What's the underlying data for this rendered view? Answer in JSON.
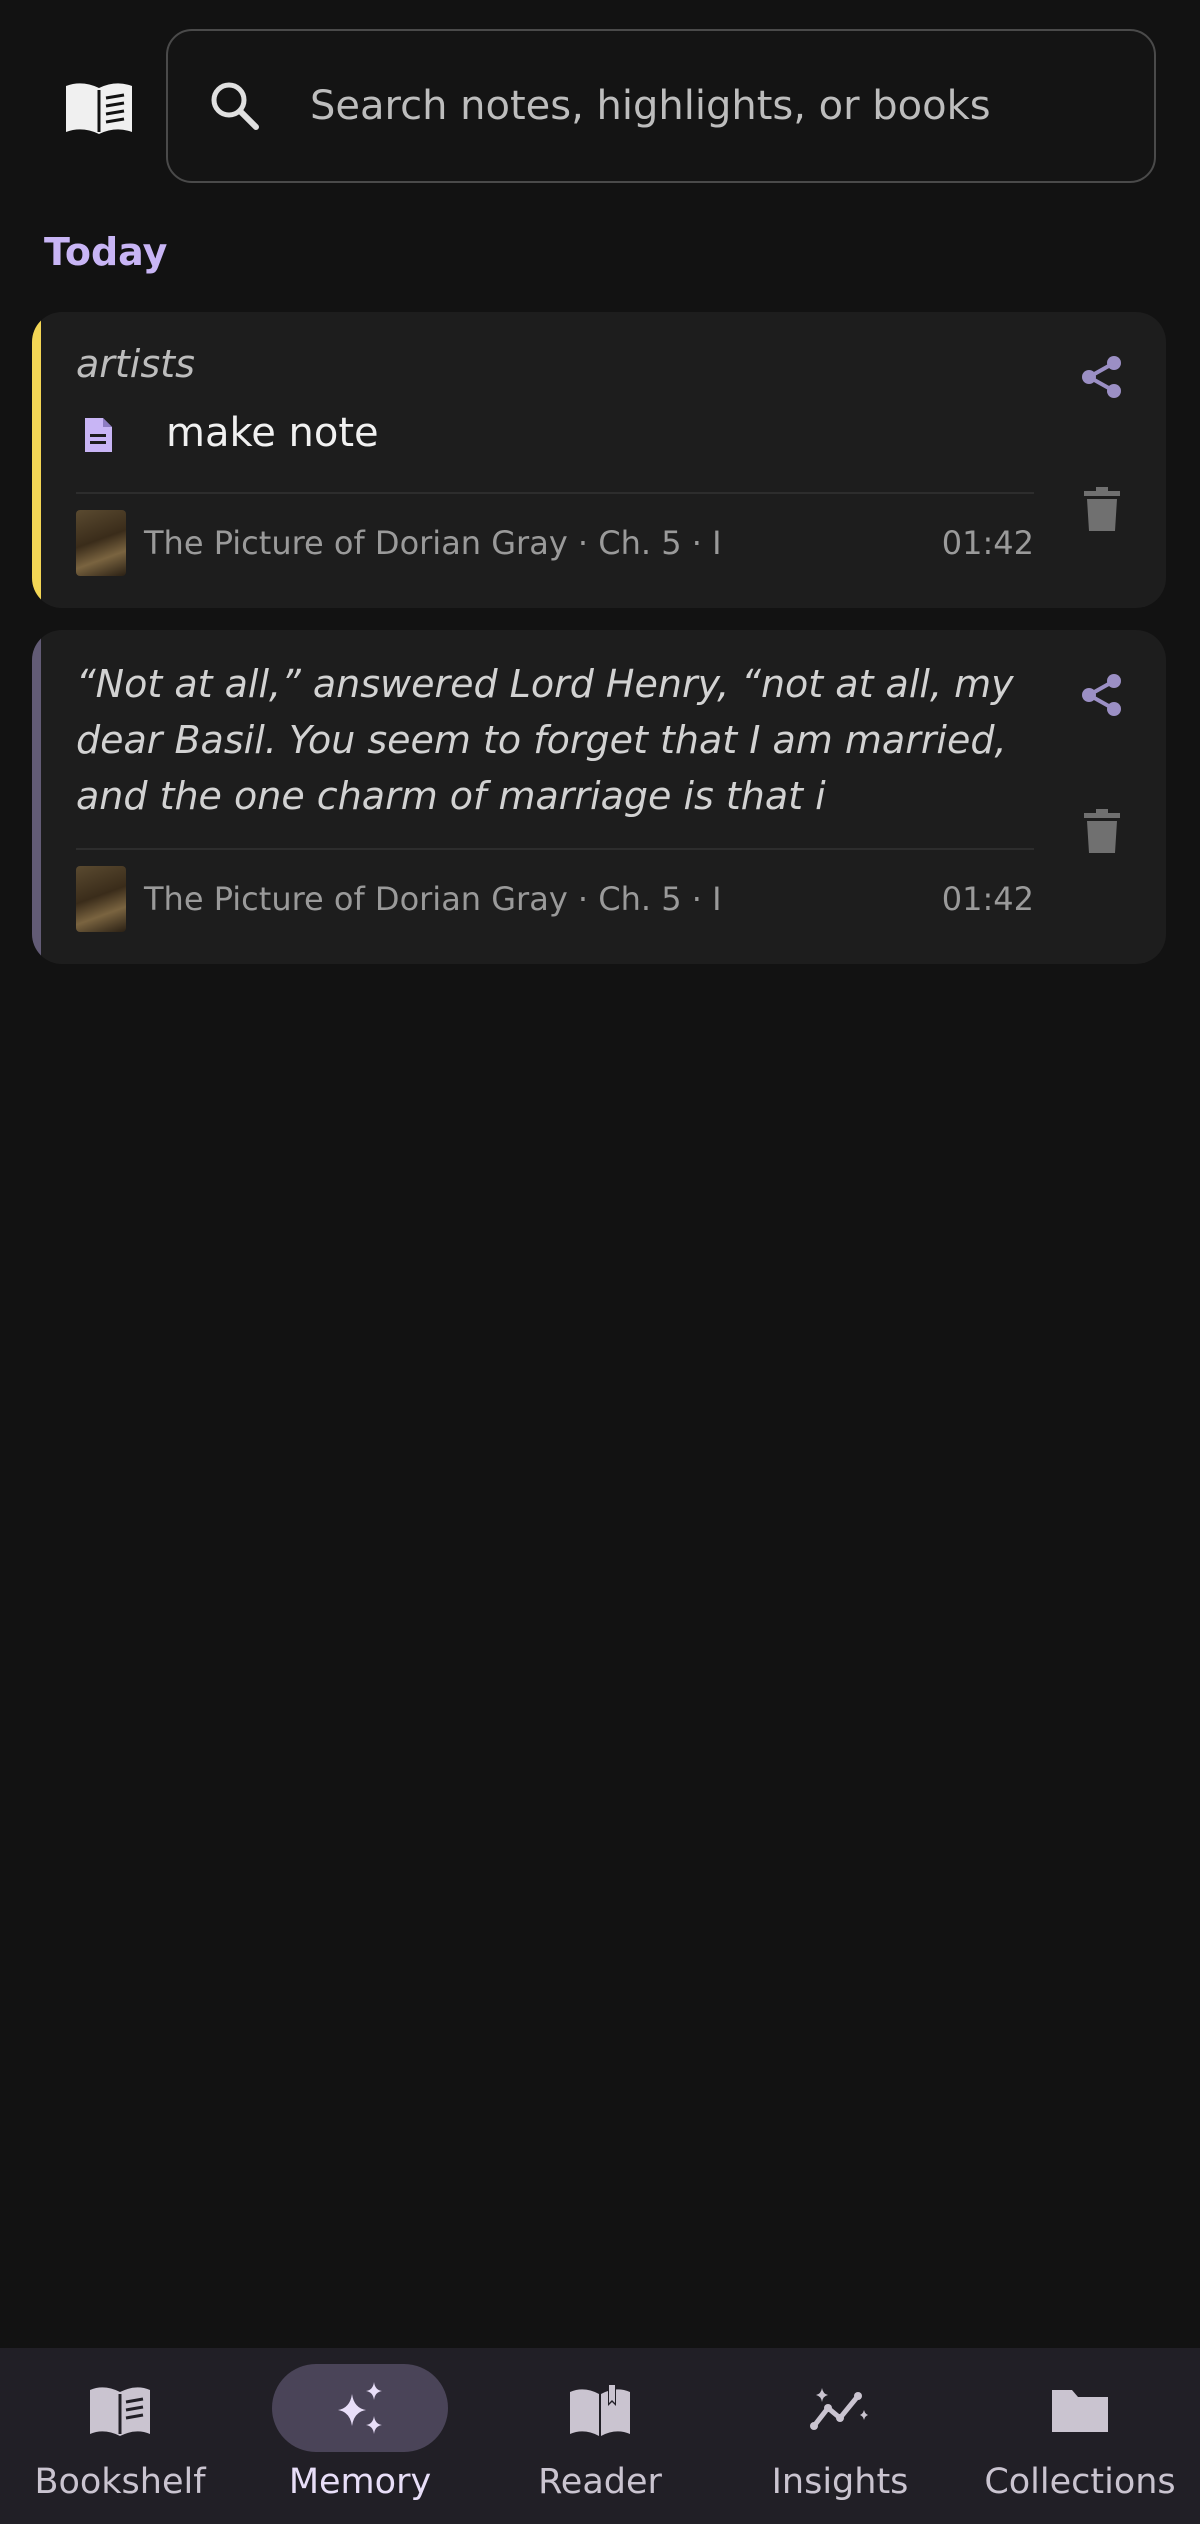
{
  "search": {
    "placeholder": "Search notes, highlights, or books",
    "icon": "search-icon"
  },
  "header": {
    "logo_icon": "open-book-icon"
  },
  "section": {
    "title": "Today"
  },
  "cards": [
    {
      "type": "note",
      "tag": "artists",
      "note": "make note",
      "accent_color": "#f3d655",
      "book": "The Picture of Dorian Gray · Ch. 5 · I",
      "time": "01:42"
    },
    {
      "type": "highlight",
      "quote": "“Not at all,” answered Lord Henry, “not at all, my dear Basil. You seem to forget that I am married, and the one charm of marriage is that i",
      "accent_color": "#625b75",
      "book": "The Picture of Dorian Gray · Ch. 5 · I",
      "time": "01:42"
    }
  ],
  "nav": {
    "items": [
      {
        "label": "Bookshelf",
        "icon": "book-icon",
        "active": false
      },
      {
        "label": "Memory",
        "icon": "sparkle-icon",
        "active": true
      },
      {
        "label": "Reader",
        "icon": "reader-icon",
        "active": false
      },
      {
        "label": "Insights",
        "icon": "insights-icon",
        "active": false
      },
      {
        "label": "Collections",
        "icon": "folder-icon",
        "active": false
      }
    ]
  },
  "colors": {
    "accent_purple": "#c8b5f5",
    "icon_purple": "#9b8fc4",
    "background": "#121212",
    "card": "#1d1d1d",
    "nav_active_pill": "#4a4458"
  }
}
